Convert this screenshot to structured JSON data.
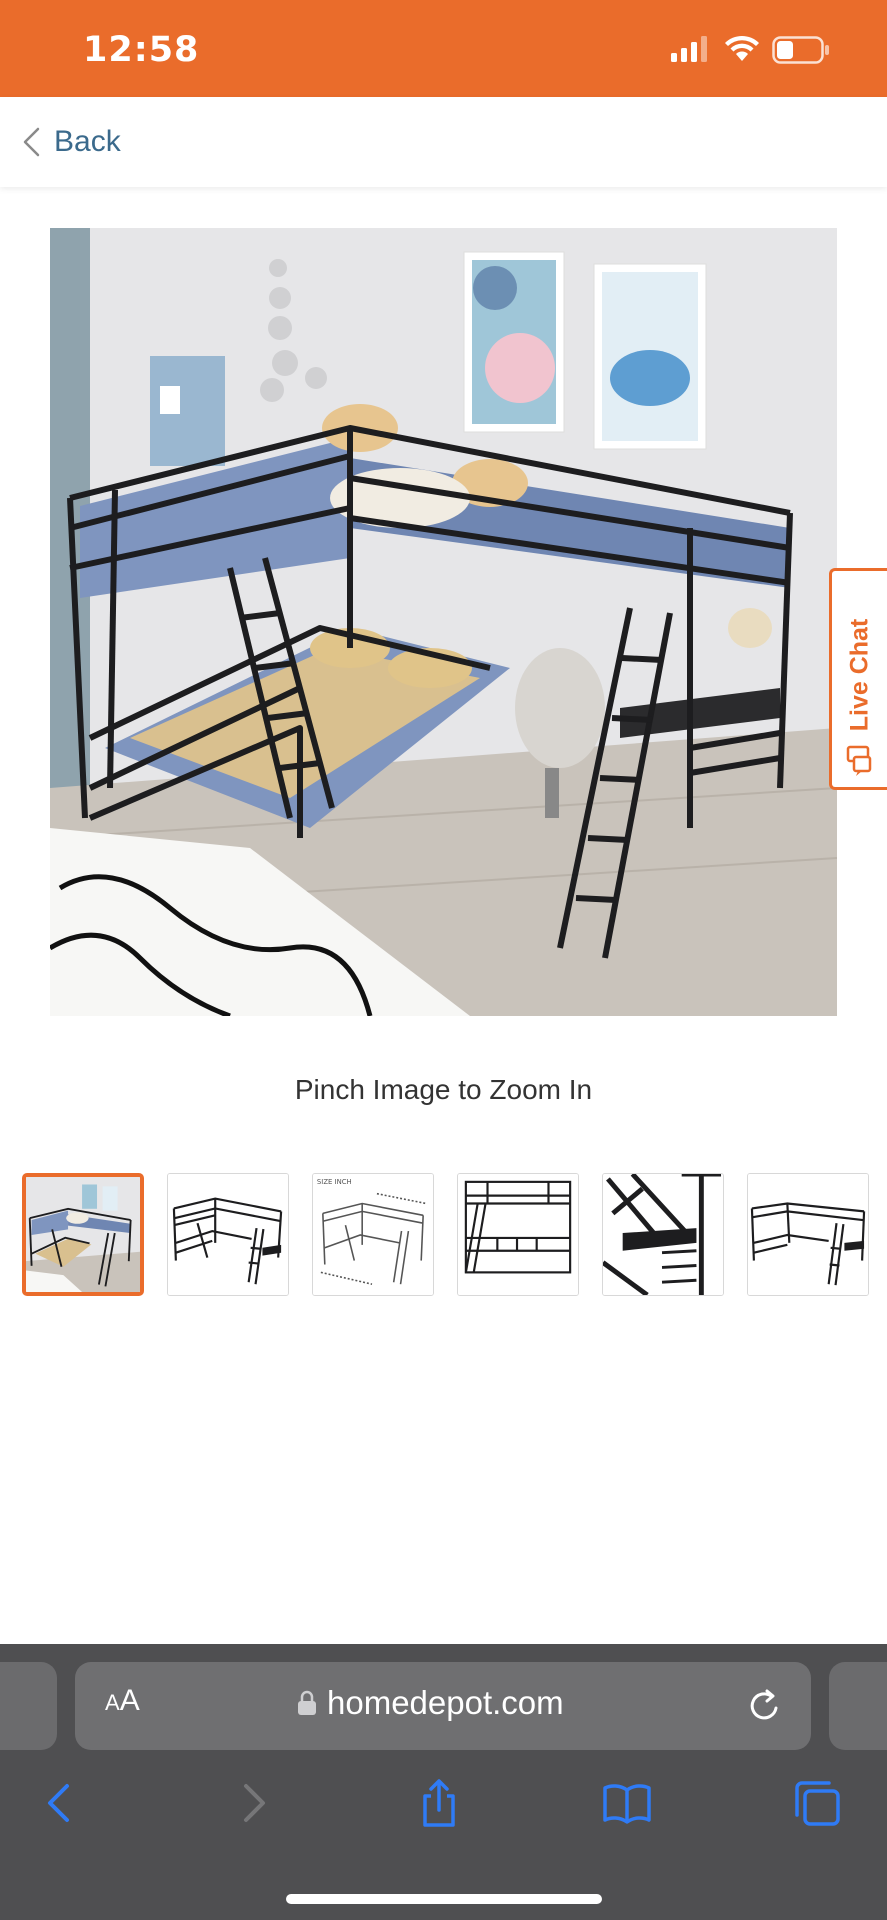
{
  "status_bar": {
    "time": "12:58",
    "background": "#ea6c2b"
  },
  "header": {
    "back_label": "Back"
  },
  "product_gallery": {
    "main_image_alt": "L-shaped metal bunk bed with loft, ladders and desk",
    "zoom_hint": "Pinch Image to Zoom In",
    "thumbnails": [
      {
        "name": "bunk-bed-room-photo",
        "selected": true
      },
      {
        "name": "bunk-bed-front-view",
        "selected": false
      },
      {
        "name": "bunk-bed-size-diagram",
        "selected": false
      },
      {
        "name": "bunk-bed-side-view",
        "selected": false
      },
      {
        "name": "bunk-bed-desk-closeup",
        "selected": false
      },
      {
        "name": "bunk-bed-angle-view",
        "selected": false
      }
    ]
  },
  "live_chat": {
    "label": "Live Chat"
  },
  "safari": {
    "text_size_small": "A",
    "text_size_large": "A",
    "url": "homedepot.com"
  },
  "colors": {
    "accent": "#ea6c2b",
    "link": "#3b6a8c",
    "safari_blue": "#2f7bf6"
  }
}
